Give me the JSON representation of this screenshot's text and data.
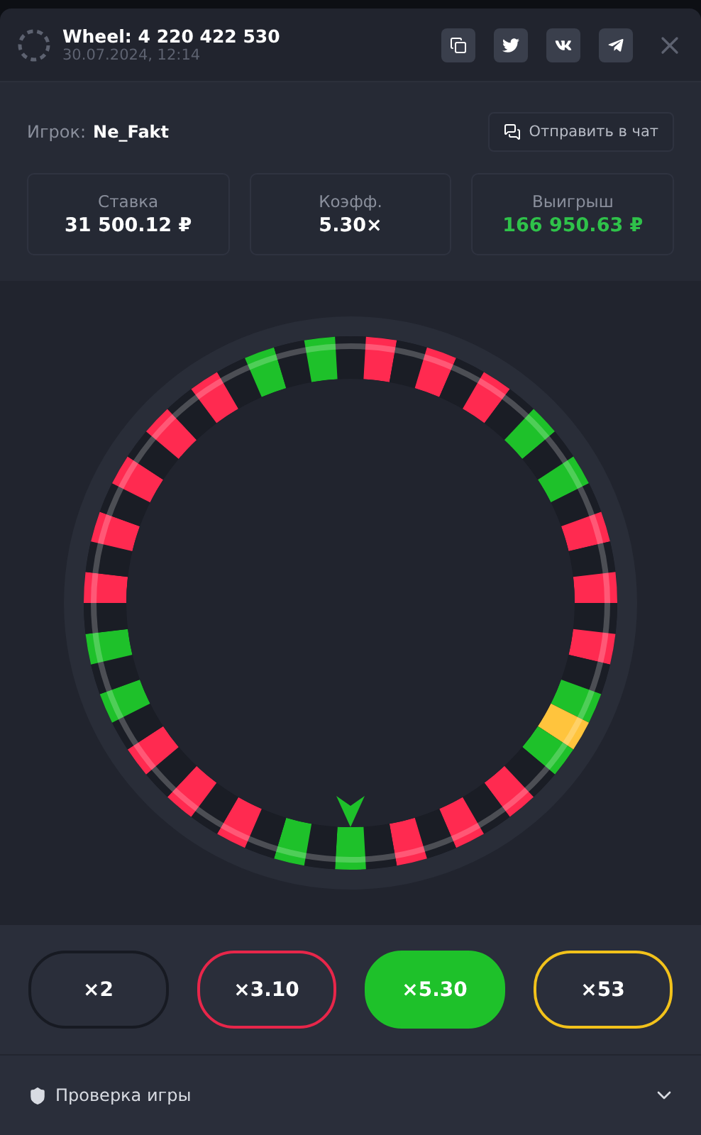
{
  "header": {
    "title": "Wheel: 4 220 422 530",
    "date": "30.07.2024, 12:14"
  },
  "player": {
    "label": "Игрок:",
    "name": "Ne_Fakt",
    "send_button": "Отправить в чат"
  },
  "stats": [
    {
      "label": "Ставка",
      "value": "31 500.12 ₽",
      "positive": false
    },
    {
      "label": "Коэфф.",
      "value": "5.30×",
      "positive": false
    },
    {
      "label": "Выигрыш",
      "value": "166 950.63 ₽",
      "positive": true
    }
  ],
  "wheel": {
    "slots": [
      {
        "color": "#1a1d25"
      },
      {
        "color": "#ff2a50"
      },
      {
        "color": "#1a1d25"
      },
      {
        "color": "#ff2a50"
      },
      {
        "color": "#1a1d25"
      },
      {
        "color": "#ff2a50"
      },
      {
        "color": "#1a1d25"
      },
      {
        "color": "#1ec12a"
      },
      {
        "color": "#1a1d25"
      },
      {
        "color": "#1ec12a"
      },
      {
        "color": "#1a1d25"
      },
      {
        "color": "#ff2a50"
      },
      {
        "color": "#1a1d25"
      },
      {
        "color": "#ff2a50"
      },
      {
        "color": "#1a1d25"
      },
      {
        "color": "#ff2a50"
      },
      {
        "color": "#1a1d25"
      },
      {
        "color": "#1ec12a"
      },
      {
        "color": "#ffc43d"
      },
      {
        "color": "#1ec12a"
      },
      {
        "color": "#1a1d25"
      },
      {
        "color": "#ff2a50"
      },
      {
        "color": "#1a1d25"
      },
      {
        "color": "#ff2a50"
      },
      {
        "color": "#1a1d25"
      },
      {
        "color": "#ff2a50"
      },
      {
        "color": "#1a1d25"
      },
      {
        "color": "#1ec12a"
      },
      {
        "color": "#1a1d25"
      },
      {
        "color": "#1ec12a"
      },
      {
        "color": "#1a1d25"
      },
      {
        "color": "#ff2a50"
      },
      {
        "color": "#1a1d25"
      },
      {
        "color": "#ff2a50"
      },
      {
        "color": "#1a1d25"
      },
      {
        "color": "#ff2a50"
      },
      {
        "color": "#1a1d25"
      },
      {
        "color": "#1ec12a"
      },
      {
        "color": "#1a1d25"
      },
      {
        "color": "#1ec12a"
      },
      {
        "color": "#1a1d25"
      },
      {
        "color": "#ff2a50"
      },
      {
        "color": "#1a1d25"
      },
      {
        "color": "#ff2a50"
      },
      {
        "color": "#1a1d25"
      },
      {
        "color": "#ff2a50"
      },
      {
        "color": "#1a1d25"
      },
      {
        "color": "#ff2a50"
      },
      {
        "color": "#1a1d25"
      },
      {
        "color": "#ff2a50"
      },
      {
        "color": "#1a1d25"
      },
      {
        "color": "#1ec12a"
      },
      {
        "color": "#1a1d25"
      },
      {
        "color": "#1ec12a"
      }
    ]
  },
  "multipliers": [
    {
      "label": "×2",
      "color": "#171a22",
      "selected": false
    },
    {
      "label": "×3.10",
      "color": "#e8264a",
      "selected": false
    },
    {
      "label": "×5.30",
      "color": "#1ec12a",
      "selected": true
    },
    {
      "label": "×53",
      "color": "#f2c21b",
      "selected": false
    }
  ],
  "footer": {
    "label": "Проверка игры",
    "expanded": false
  }
}
